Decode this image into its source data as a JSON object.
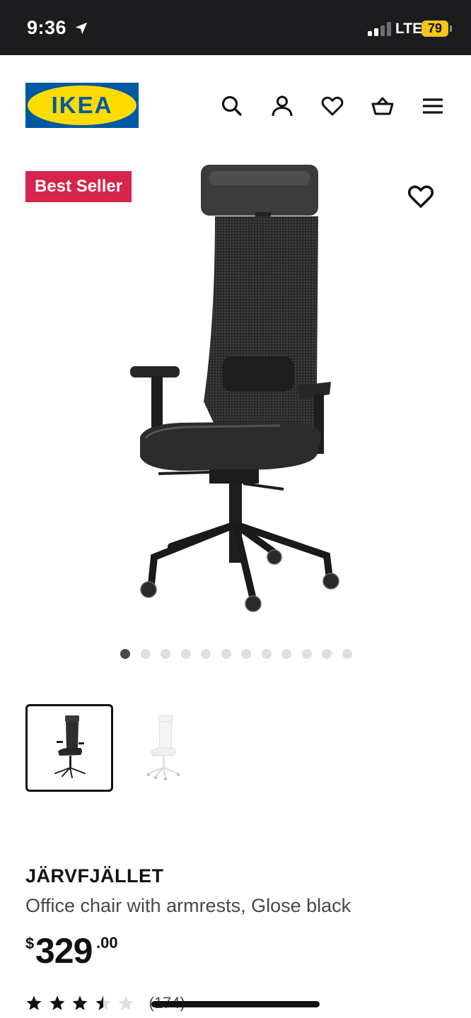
{
  "status_bar": {
    "time": "9:36",
    "network": "LTE",
    "battery": "79",
    "icons": [
      "location-arrow-icon",
      "signal-icon",
      "battery-icon"
    ]
  },
  "header": {
    "logo_text": "IKEA",
    "icons": [
      "search-icon",
      "account-icon",
      "heart-icon",
      "cart-icon",
      "menu-icon"
    ]
  },
  "gallery": {
    "badge": "Best Seller",
    "image_count": 12,
    "active_index": 0,
    "thumbnails": [
      {
        "variant": "Glose black",
        "selected": true
      },
      {
        "variant": "white",
        "selected": false
      }
    ]
  },
  "product": {
    "name": "JÄRVFJÄLLET",
    "description": "Office chair with armrests, Glose black",
    "price": {
      "currency": "$",
      "integer": "329",
      "decimal": ".00"
    },
    "rating": {
      "value": 3.5,
      "max": 5,
      "count_label": "(174)"
    }
  },
  "colors": {
    "status_bar_bg": "#1c1c1e",
    "ikea_blue": "#0058a3",
    "ikea_yellow": "#ffdb00",
    "badge_red": "#d6244b",
    "battery_yellow": "#f5c518"
  }
}
